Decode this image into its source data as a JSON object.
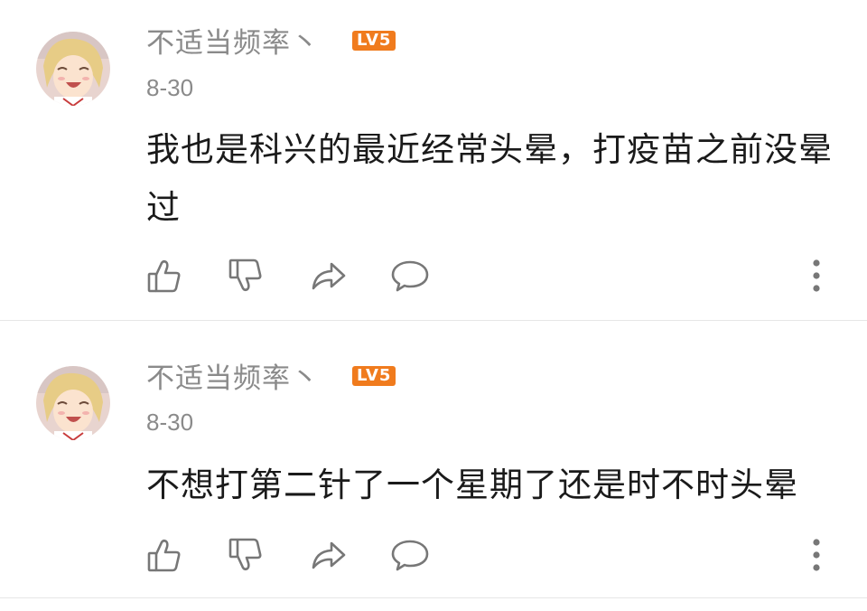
{
  "comments": [
    {
      "username": "不适当频率丶",
      "level": "LV5",
      "date": "8-30",
      "text": "我也是科兴的最近经常头晕，打疫苗之前没晕过"
    },
    {
      "username": "不适当频率丶",
      "level": "LV5",
      "date": "8-30",
      "text": "不想打第二针了一个星期了还是时不时头晕"
    }
  ],
  "icons": {
    "like": "thumbs-up-icon",
    "dislike": "thumbs-down-icon",
    "share": "share-arrow-icon",
    "reply": "speech-bubble-icon",
    "more": "vertical-ellipsis-icon"
  },
  "colors": {
    "level_badge": "#f07b1d",
    "meta_text": "#8a8a8a",
    "body_text": "#1a1a1a",
    "icon": "#777777"
  }
}
